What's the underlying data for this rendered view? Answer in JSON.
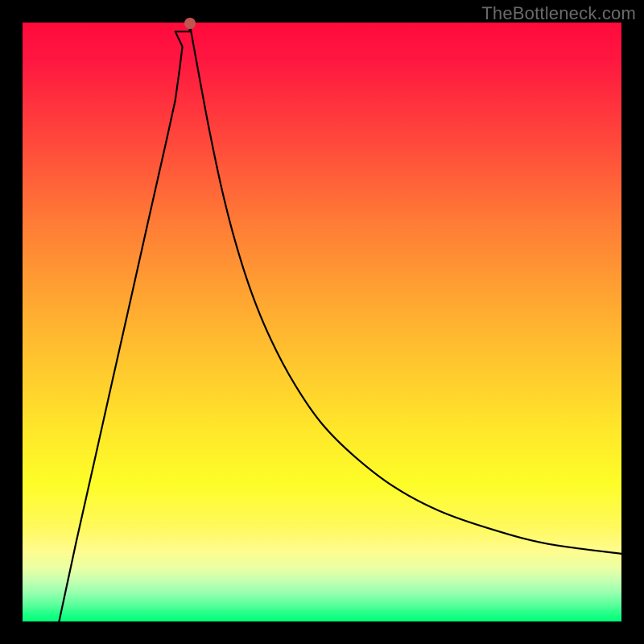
{
  "watermark": "TheBottleneck.com",
  "dot": {
    "x_frac": 0.279,
    "y_frac": 0.998
  },
  "chart_data": {
    "type": "line",
    "title": "",
    "xlabel": "",
    "ylabel": "",
    "xlim": [
      0,
      1
    ],
    "ylim": [
      0,
      1
    ],
    "series": [
      {
        "name": "left-branch",
        "x": [
          0.061,
          0.09,
          0.12,
          0.15,
          0.18,
          0.21,
          0.24,
          0.255,
          0.262,
          0.267
        ],
        "y": [
          0.0,
          0.135,
          0.268,
          0.402,
          0.535,
          0.669,
          0.802,
          0.87,
          0.92,
          0.96
        ]
      },
      {
        "name": "valley-flat",
        "x": [
          0.255,
          0.279
        ],
        "y": [
          0.985,
          0.985
        ]
      },
      {
        "name": "right-branch",
        "x": [
          0.279,
          0.295,
          0.312,
          0.332,
          0.355,
          0.382,
          0.415,
          0.455,
          0.5,
          0.555,
          0.62,
          0.695,
          0.78,
          0.875,
          1.0
        ],
        "y": [
          0.998,
          0.91,
          0.82,
          0.725,
          0.635,
          0.55,
          0.47,
          0.395,
          0.33,
          0.275,
          0.225,
          0.185,
          0.155,
          0.13,
          0.113
        ]
      }
    ]
  }
}
